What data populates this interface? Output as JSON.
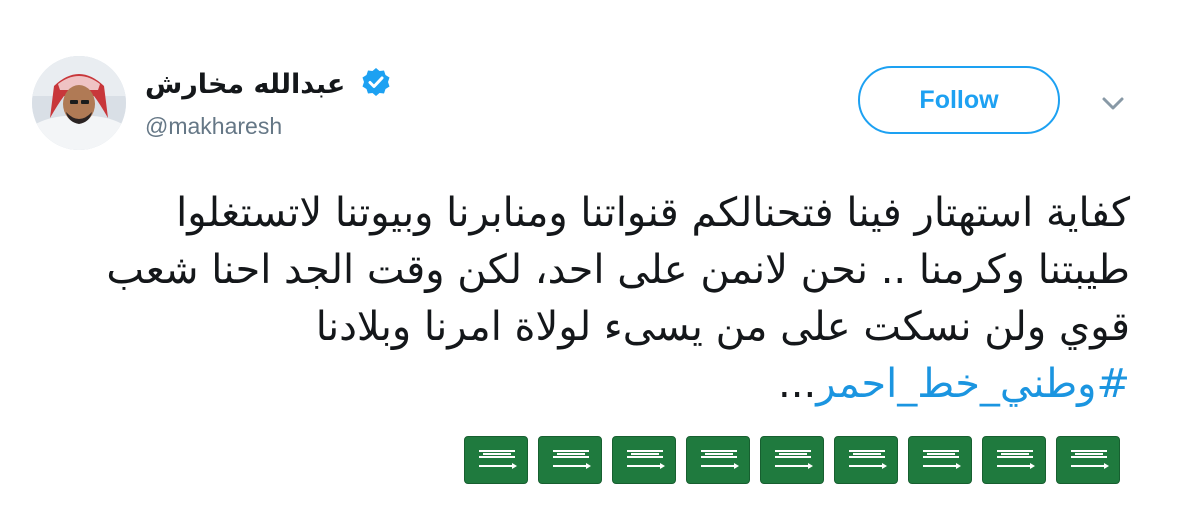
{
  "tweet": {
    "author": {
      "display_name": "عبدالله مخارش",
      "handle": "@makharesh",
      "verified": true,
      "avatar_icon": "profile-photo"
    },
    "follow_label": "Follow",
    "menu_icon": "chevron-down-icon",
    "text_lines": [
      "كفاية استهتار فينا فتحنالكم قنواتنا ومنابرنا وبيوتنا لاتستغلوا",
      "طيبتنا وكرمنا .. نحن لانمن على احد، لكن وقت الجد احنا شعب",
      "قوي ولن نسكت على من يسىء لولاة امرنا وبلادنا"
    ],
    "hashtag": "#وطني_خط_احمر",
    "ellipsis": "...",
    "emoji_flags": [
      "saudi-flag",
      "saudi-flag",
      "saudi-flag",
      "saudi-flag",
      "saudi-flag",
      "saudi-flag",
      "saudi-flag",
      "saudi-flag",
      "saudi-flag"
    ]
  },
  "colors": {
    "accent": "#1da1f2",
    "hashtag": "#1b95e0",
    "text": "#14171a",
    "muted": "#657786",
    "flag_green": "#1f7a3e"
  }
}
